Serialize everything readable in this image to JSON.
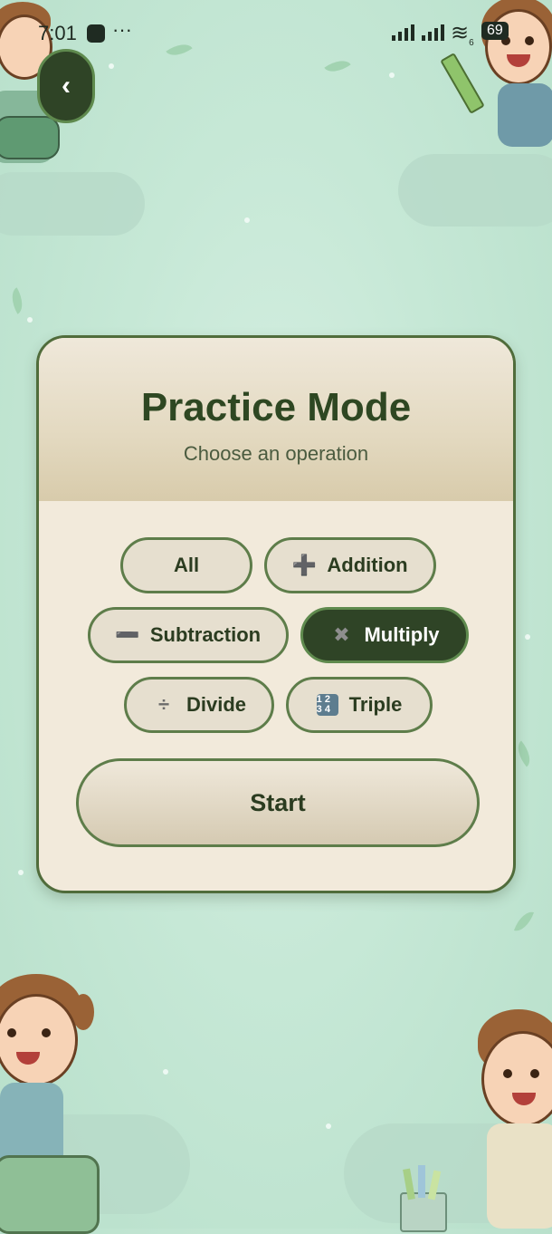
{
  "status_bar": {
    "time": "7:01",
    "more": "···",
    "wifi_suffix": "6",
    "battery": "69"
  },
  "back_button": {
    "icon": "chevron-left-icon",
    "glyph": "‹"
  },
  "card": {
    "title": "Practice Mode",
    "subtitle": "Choose an operation"
  },
  "operations": {
    "all": {
      "label": "All",
      "selected": false
    },
    "addition": {
      "label": "Addition",
      "icon": "plus-icon",
      "glyph": "➕",
      "selected": false
    },
    "subtraction": {
      "label": "Subtraction",
      "icon": "minus-icon",
      "glyph": "➖",
      "selected": false
    },
    "multiply": {
      "label": "Multiply",
      "icon": "multiply-icon",
      "glyph": "✖",
      "selected": true
    },
    "divide": {
      "label": "Divide",
      "icon": "divide-icon",
      "glyph": "÷",
      "selected": false
    },
    "triple": {
      "label": "Triple",
      "icon": "numbers-icon",
      "glyph": "1 2 3 4",
      "selected": false
    }
  },
  "start_label": "Start",
  "colors": {
    "accent_dark": "#2f4426",
    "title_green": "#2e4722",
    "card_bg": "#f2eadb",
    "background": "#c6e8d6"
  }
}
